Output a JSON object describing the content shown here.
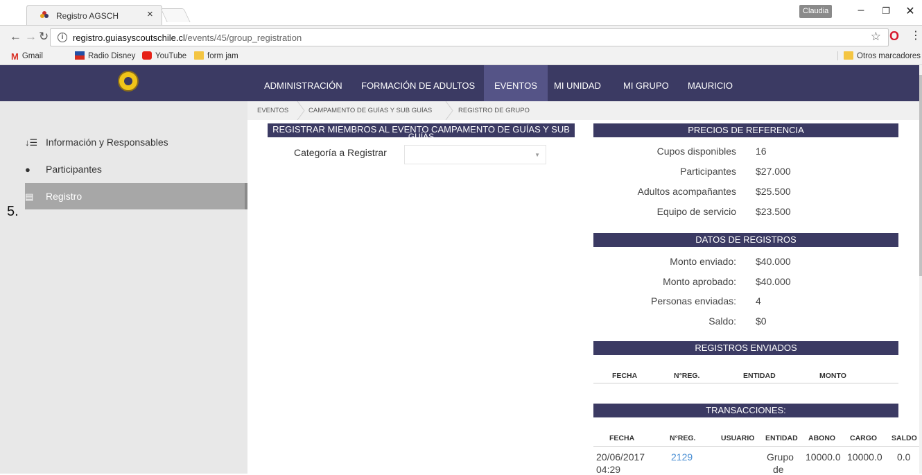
{
  "browser": {
    "tab_title": "Registro AGSCH",
    "tab_close": "×",
    "profile_name": "Claudia",
    "url_host": "registro.guiasyscoutschile.cl",
    "url_path": "/events/45/group_registration",
    "bookmarks": [
      {
        "label": "Gmail",
        "icon": "gmail-icon"
      },
      {
        "label": "Radio Disney",
        "icon": "flag-icon"
      },
      {
        "label": "YouTube",
        "icon": "youtube-icon"
      },
      {
        "label": "form jam",
        "icon": "folder-icon"
      }
    ],
    "other_bookmarks": "Otros marcadores"
  },
  "nav": {
    "items": [
      {
        "label": "ADMINISTRACIÓN"
      },
      {
        "label": "FORMACIÓN DE ADULTOS"
      },
      {
        "label": "EVENTOS",
        "active": true
      },
      {
        "label": "MI UNIDAD"
      },
      {
        "label": "MI GRUPO"
      },
      {
        "label": "MAURICIO"
      }
    ]
  },
  "sidebar": {
    "items": [
      {
        "label": "Información y Responsables",
        "icon": "sort-list-icon"
      },
      {
        "label": "Participantes",
        "icon": "user-icon"
      },
      {
        "label": "Registro",
        "icon": "list-icon",
        "active": true
      }
    ],
    "marker": "5."
  },
  "breadcrumb": [
    "EVENTOS",
    "CAMPAMENTO DE GUÍAS Y SUB GUÍAS",
    "REGISTRO DE GRUPO"
  ],
  "registration": {
    "header": "REGISTRAR MIEMBROS AL EVENTO CAMPAMENTO DE GUÍAS Y SUB",
    "header_overflow": "GUÍAS",
    "category_label": "Categoría a Registrar",
    "category_value": ""
  },
  "prices": {
    "header": "PRECIOS DE REFERENCIA",
    "rows": [
      {
        "label": "Cupos disponibles",
        "value": "16"
      },
      {
        "label": "Participantes",
        "value": "$27.000"
      },
      {
        "label": "Adultos acompañantes",
        "value": "$25.500"
      },
      {
        "label": "Equipo de servicio",
        "value": "$23.500"
      }
    ]
  },
  "registry_data": {
    "header": "DATOS DE REGISTROS",
    "rows": [
      {
        "label": "Monto enviado:",
        "value": "$40.000"
      },
      {
        "label": "Monto aprobado:",
        "value": "$40.000"
      },
      {
        "label": "Personas enviadas:",
        "value": "4"
      },
      {
        "label": "Saldo:",
        "value": "$0"
      }
    ]
  },
  "sent_registries": {
    "header": "REGISTROS ENVIADOS",
    "columns": [
      "FECHA",
      "N°REG.",
      "ENTIDAD",
      "MONTO"
    ]
  },
  "transactions": {
    "header": "TRANSACCIONES:",
    "columns": [
      "FECHA",
      "N°REG.",
      "USUARIO",
      "ENTIDAD",
      "ABONO",
      "CARGO",
      "SALDO"
    ],
    "rows": [
      {
        "fecha_date": "20/06/2017",
        "fecha_time": "04:29",
        "nreg": "2129",
        "usuario": "",
        "entidad_line1": "Grupo",
        "entidad_line2": "de",
        "abono": "10000.0",
        "cargo": "10000.0",
        "saldo": "0.0"
      }
    ]
  }
}
